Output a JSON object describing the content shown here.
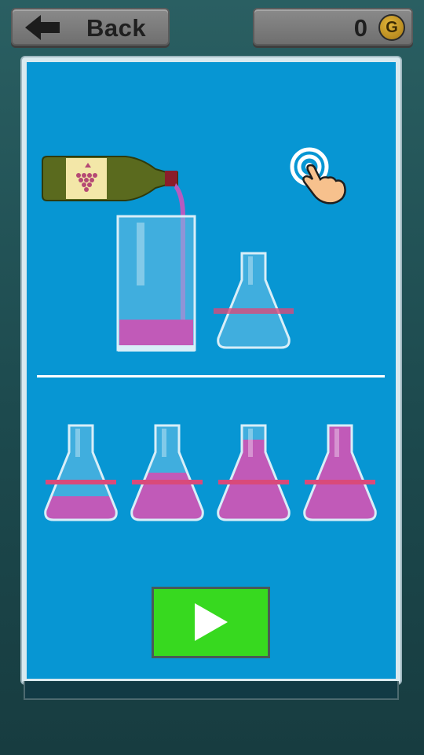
{
  "header": {
    "back_label": "Back",
    "coins": "0",
    "coin_symbol": "G"
  },
  "demo": {
    "glass_fill_fraction": 0.22,
    "target_flask_line_fraction": 0.4
  },
  "options": [
    {
      "fill_fraction": 0.25,
      "line_fraction": 0.4
    },
    {
      "fill_fraction": 0.5,
      "line_fraction": 0.4
    },
    {
      "fill_fraction": 0.85,
      "line_fraction": 0.4
    },
    {
      "fill_fraction": 1.0,
      "line_fraction": 0.4
    }
  ],
  "colors": {
    "liquid": "#c15ab8",
    "target_line": "#d94a7a",
    "panel": "#0796d3",
    "play_button": "#37d91f"
  },
  "icons": [
    "arrow-left-icon",
    "coin-icon",
    "wine-bottle-icon",
    "tap-hand-icon",
    "play-icon"
  ]
}
